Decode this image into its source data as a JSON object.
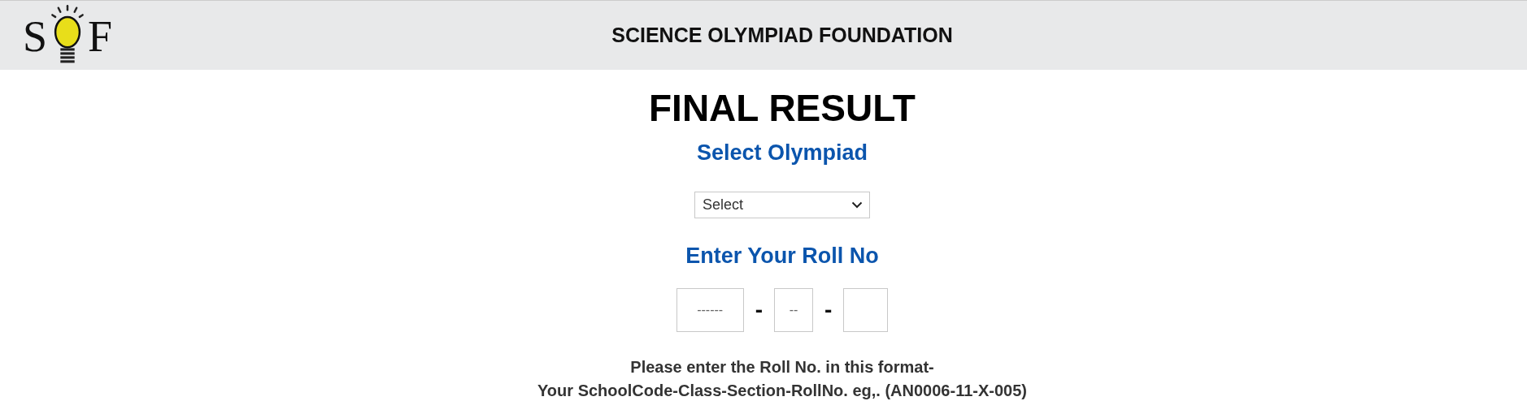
{
  "header": {
    "logo": {
      "left_letter": "S",
      "right_letter": "F"
    },
    "title": "SCIENCE OLYMPIAD FOUNDATION"
  },
  "page_title": "FINAL RESULT",
  "olympiad": {
    "heading": "Select Olympiad",
    "select": {
      "value": "Select"
    }
  },
  "roll_no": {
    "heading": "Enter Your Roll No",
    "fields": [
      {
        "kind": "input",
        "placeholder": "------"
      },
      {
        "kind": "input",
        "placeholder": "--"
      },
      {
        "kind": "input"
      }
    ],
    "separators": [
      "-",
      "-"
    ]
  },
  "hint": [
    "Please enter the Roll No. in this format-",
    "Your SchoolCode-Class-Section-RollNo. eg,. (AN0006-11-X-005)"
  ]
}
